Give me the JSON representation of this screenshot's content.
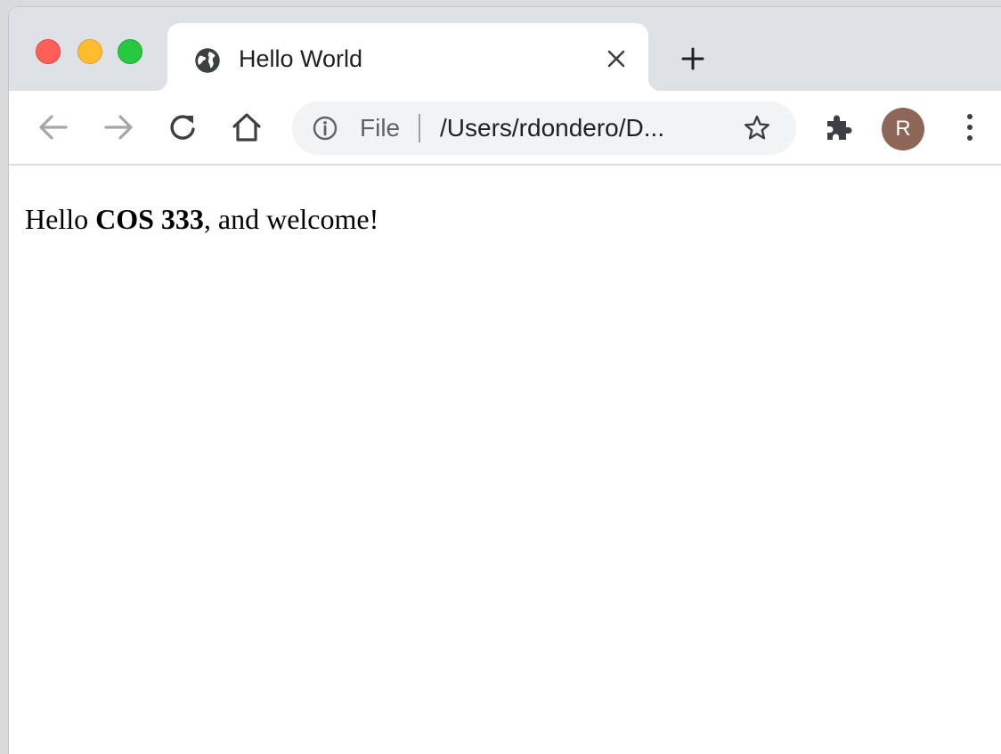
{
  "tab": {
    "title": "Hello World"
  },
  "toolbar": {
    "scheme_label": "File",
    "url": "/Users/rdondero/D...",
    "profile_initial": "R"
  },
  "page": {
    "greeting_prefix": "Hello ",
    "greeting_bold": "COS 333",
    "greeting_suffix": ", and welcome!"
  },
  "colors": {
    "close_red": "#ff5f57",
    "minimize_yellow": "#febc2e",
    "zoom_green": "#28c840",
    "avatar_brown": "#8d6657"
  },
  "icons": {
    "tab_favicon": "globe-icon",
    "back": "arrow-left-icon",
    "forward": "arrow-right-icon",
    "reload": "reload-icon",
    "home": "home-icon",
    "site_info": "info-icon",
    "bookmark": "star-icon",
    "extensions": "puzzle-icon",
    "menu": "kebab-menu-icon"
  }
}
